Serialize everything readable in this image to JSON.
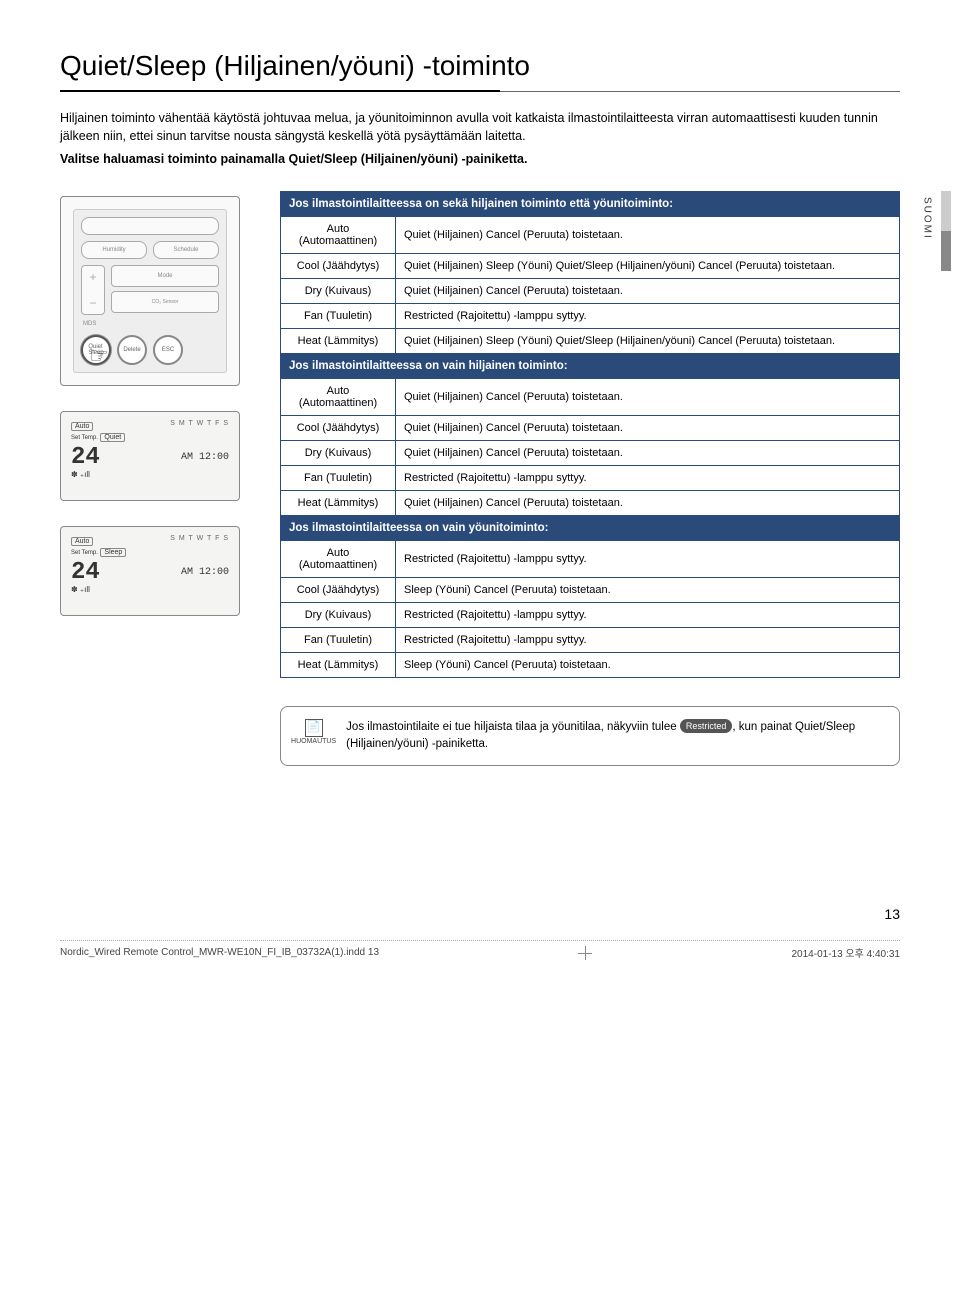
{
  "title": "Quiet/Sleep (Hiljainen/yöuni) -toiminto",
  "intro1": "Hiljainen toiminto vähentää käytöstä johtuvaa melua, ja yöunitoiminnon avulla voit katkaista ilmastointilaitteesta virran automaattisesti kuuden tunnin jälkeen niin, ettei sinun tarvitse nousta sängystä keskellä yötä pysäyttämään laitetta.",
  "intro2": "Valitse haluamasi toiminto painamalla Quiet/Sleep (Hiljainen/yöuni) -painiketta.",
  "side_label": "SUOMI",
  "sections": [
    {
      "header": "Jos ilmastointilaitteessa on sekä hiljainen toiminto että yöunitoiminto:",
      "rows": [
        {
          "mode": "Auto (Automaattinen)",
          "desc": "Quiet (Hiljainen)  Cancel (Peruuta) toistetaan."
        },
        {
          "mode": "Cool (Jäähdytys)",
          "desc": "Quiet (Hiljainen)  Sleep (Yöuni)  Quiet/Sleep (Hiljainen/yöuni)  Cancel (Peruuta) toistetaan."
        },
        {
          "mode": "Dry (Kuivaus)",
          "desc": "Quiet (Hiljainen)  Cancel (Peruuta) toistetaan."
        },
        {
          "mode": "Fan (Tuuletin)",
          "desc": "Restricted (Rajoitettu) -lamppu syttyy."
        },
        {
          "mode": "Heat (Lämmitys)",
          "desc": "Quiet (Hiljainen)  Sleep (Yöuni)  Quiet/Sleep (Hiljainen/yöuni)  Cancel (Peruuta) toistetaan."
        }
      ]
    },
    {
      "header": "Jos ilmastointilaitteessa on vain hiljainen toiminto:",
      "rows": [
        {
          "mode": "Auto (Automaattinen)",
          "desc": "Quiet (Hiljainen)  Cancel (Peruuta) toistetaan."
        },
        {
          "mode": "Cool (Jäähdytys)",
          "desc": "Quiet (Hiljainen)  Cancel (Peruuta) toistetaan."
        },
        {
          "mode": "Dry (Kuivaus)",
          "desc": "Quiet (Hiljainen)  Cancel (Peruuta) toistetaan."
        },
        {
          "mode": "Fan (Tuuletin)",
          "desc": "Restricted (Rajoitettu) -lamppu syttyy."
        },
        {
          "mode": "Heat (Lämmitys)",
          "desc": "Quiet (Hiljainen)  Cancel (Peruuta) toistetaan."
        }
      ]
    },
    {
      "header": "Jos ilmastointilaitteessa on vain yöunitoiminto:",
      "rows": [
        {
          "mode": "Auto (Automaattinen)",
          "desc": "Restricted (Rajoitettu) -lamppu syttyy."
        },
        {
          "mode": "Cool (Jäähdytys)",
          "desc": "Sleep (Yöuni)  Cancel (Peruuta) toistetaan."
        },
        {
          "mode": "Dry (Kuivaus)",
          "desc": "Restricted (Rajoitettu) -lamppu syttyy."
        },
        {
          "mode": "Fan (Tuuletin)",
          "desc": "Restricted (Rajoitettu) -lamppu syttyy."
        },
        {
          "mode": "Heat (Lämmitys)",
          "desc": "Sleep (Yöuni)  Cancel (Peruuta) toistetaan."
        }
      ]
    }
  ],
  "note_label": "HUOMAUTUS",
  "note_text_pre": " Jos ilmastointilaite ei tue hiljaista tilaa ja yöunitilaa, näkyviin tulee ",
  "note_badge": "Restricted",
  "note_text_post": ", kun painat Quiet/Sleep (Hiljainen/yöuni) -painiketta.",
  "page_number": "13",
  "footer_file": "Nordic_Wired Remote Control_MWR-WE10N_FI_IB_03732A(1).indd   13",
  "footer_time": "2014-01-13   오후 4:40:31",
  "lcd_auto": "Auto",
  "lcd_quiet": "Quiet",
  "lcd_sleep": "Sleep",
  "lcd_settemp": "Set Temp.",
  "lcd_temp": "24",
  "lcd_time": "AM 12:00",
  "lcd_icons": "S M T W T F S"
}
